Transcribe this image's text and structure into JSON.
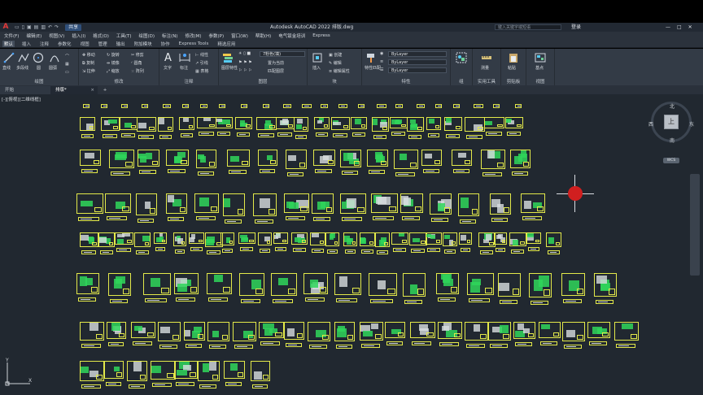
{
  "app": {
    "logo": "A",
    "title": "Autodesk AutoCAD 2022    排版.dwg",
    "share": "共享",
    "search_placeholder": "键入关键字或短语",
    "login": "登录",
    "window_controls": [
      "—",
      "□",
      "✕"
    ]
  },
  "menu": [
    "文件(F)",
    "编辑(E)",
    "视图(V)",
    "插入(I)",
    "格式(O)",
    "工具(T)",
    "绘图(D)",
    "标注(N)",
    "修改(M)",
    "参数(P)",
    "窗口(W)",
    "帮助(H)",
    "电气钣金培训",
    "Express"
  ],
  "ribbon_tabs": [
    "默认",
    "插入",
    "注释",
    "参数化",
    "视图",
    "管理",
    "输出",
    "附加模块",
    "协作",
    "Express Tools",
    "精选应用"
  ],
  "ribbon": {
    "draw": {
      "title": "绘图",
      "line": "直线",
      "polyline": "多段线",
      "circle": "圆",
      "arc": "圆弧"
    },
    "modify": {
      "title": "修改",
      "items": [
        "移动",
        "旋转",
        "修剪",
        "复制",
        "镜像",
        "圆角",
        "拉伸",
        "缩放",
        "阵列"
      ]
    },
    "annotation": {
      "title": "注释",
      "text": "文字",
      "dim": "标注",
      "linear": "线性",
      "leader": "引线",
      "table": "表格"
    },
    "layers": {
      "title": "图层",
      "properties": "图层特性",
      "current": "7粉色(填)",
      "make_current": "置为当前",
      "match": "匹配图层"
    },
    "block": {
      "title": "块",
      "insert": "插入",
      "create": "创建",
      "edit": "编辑",
      "attr": "编辑属性"
    },
    "properties": {
      "title": "特性",
      "match": "特性匹配",
      "bylayer1": "ByLayer",
      "bylayer2": "ByLayer",
      "bylayer3": "ByLayer"
    },
    "groups": {
      "title": "组",
      "group": "组"
    },
    "utilities": {
      "title": "实用工具",
      "measure": "测量"
    },
    "clipboard": {
      "title": "剪贴板",
      "paste": "粘贴"
    },
    "view": {
      "title": "视图",
      "base": "基点"
    }
  },
  "doc_tabs": {
    "start": "开始",
    "current": "排版*",
    "add": "+"
  },
  "viewport": {
    "label": "[-][俯视][二维线框]"
  },
  "viewcube": {
    "north": "北",
    "south": "南",
    "east": "东",
    "west": "西",
    "face": "上",
    "wcs": "WCS"
  },
  "ucs": {
    "x": "X",
    "y": "Y"
  },
  "colors": {
    "sheet_border": "#e3e94a",
    "green_fill": "#2fd65a",
    "canvas": "#212830",
    "cursor_red": "#d11f1f"
  }
}
